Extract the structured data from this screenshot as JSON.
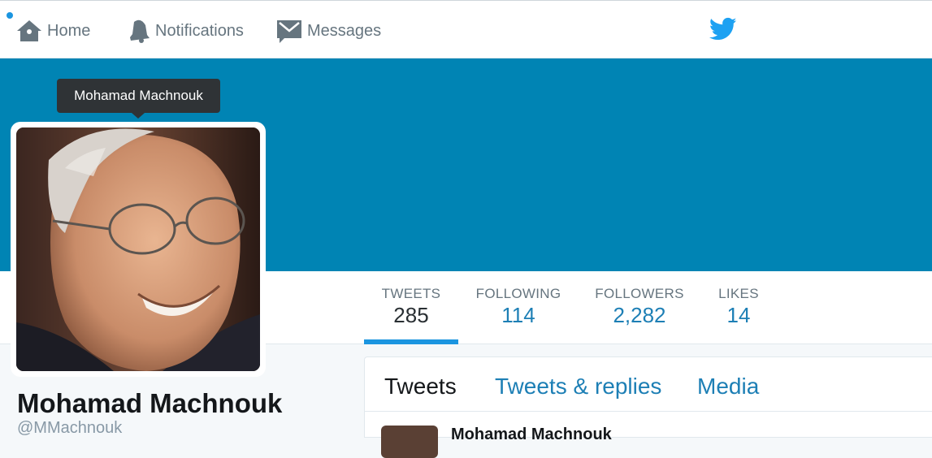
{
  "nav": {
    "home_label": "Home",
    "notifications_label": "Notifications",
    "messages_label": "Messages"
  },
  "tooltip": {
    "text": "Mohamad Machnouk"
  },
  "stats": {
    "tweets": {
      "label": "TWEETS",
      "value": "285"
    },
    "following": {
      "label": "FOLLOWING",
      "value": "114"
    },
    "followers": {
      "label": "FOLLOWERS",
      "value": "2,282"
    },
    "likes": {
      "label": "LIKES",
      "value": "14"
    }
  },
  "profile": {
    "name": "Mohamad Machnouk",
    "handle": "@MMachnouk"
  },
  "profile_tabs": {
    "tweets": "Tweets",
    "replies": "Tweets & replies",
    "media": "Media"
  },
  "tweet": {
    "author": "Mohamad Machnouk"
  },
  "colors": {
    "banner": "#0084b4",
    "accent": "#1b95e0",
    "link": "#1d7fb5"
  }
}
